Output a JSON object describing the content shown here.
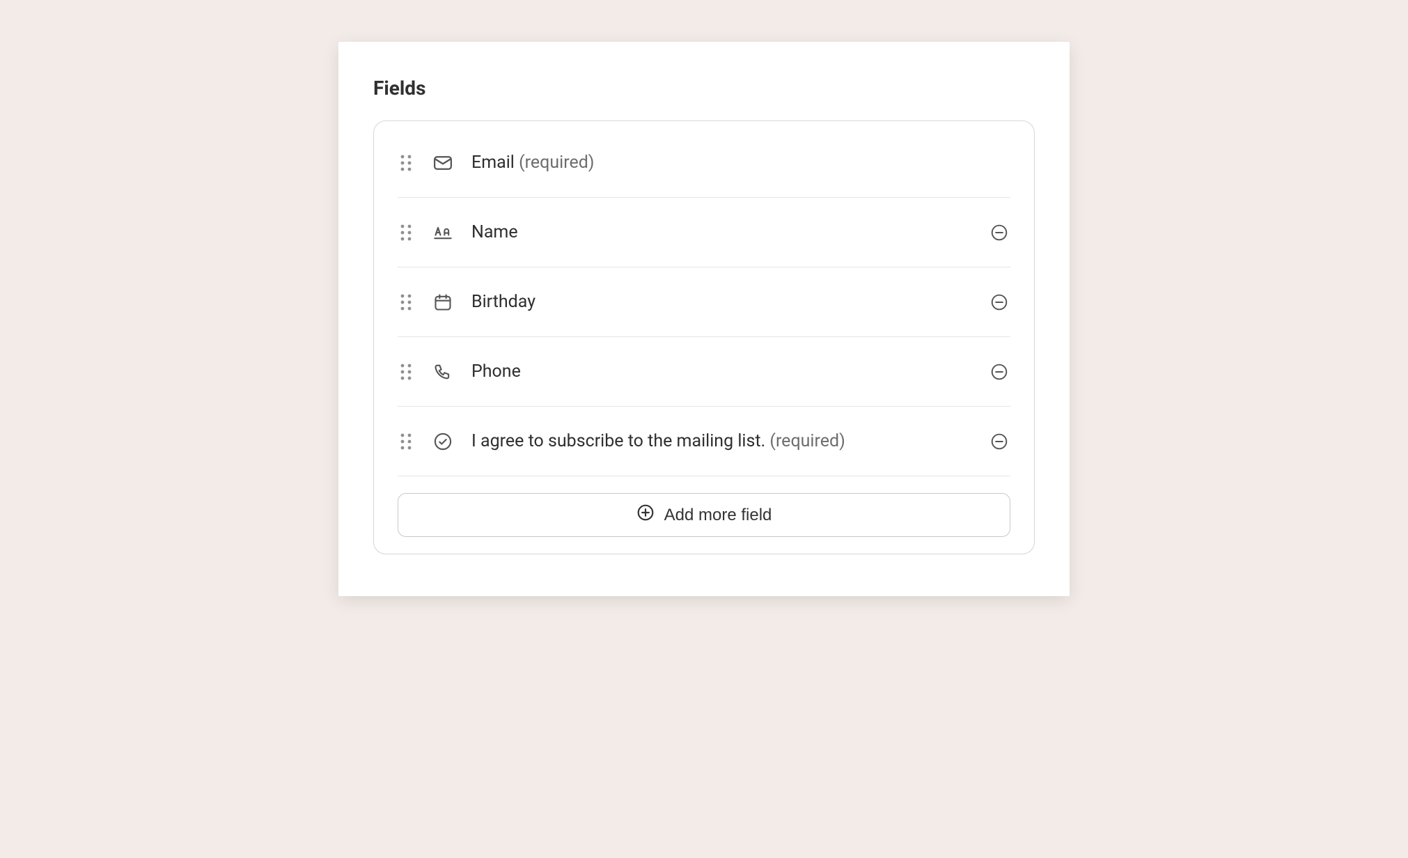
{
  "section": {
    "title": "Fields"
  },
  "fields": [
    {
      "label": "Email",
      "required_suffix": " (required)",
      "icon": "mail",
      "removable": false
    },
    {
      "label": "Name",
      "required_suffix": "",
      "icon": "text",
      "removable": true
    },
    {
      "label": "Birthday",
      "required_suffix": "",
      "icon": "calendar",
      "removable": true
    },
    {
      "label": "Phone",
      "required_suffix": "",
      "icon": "phone",
      "removable": true
    },
    {
      "label": "I agree to subscribe to the mailing list.",
      "required_suffix": " (required)",
      "icon": "check-circle",
      "removable": true
    }
  ],
  "add_button": {
    "label": "Add more field"
  }
}
